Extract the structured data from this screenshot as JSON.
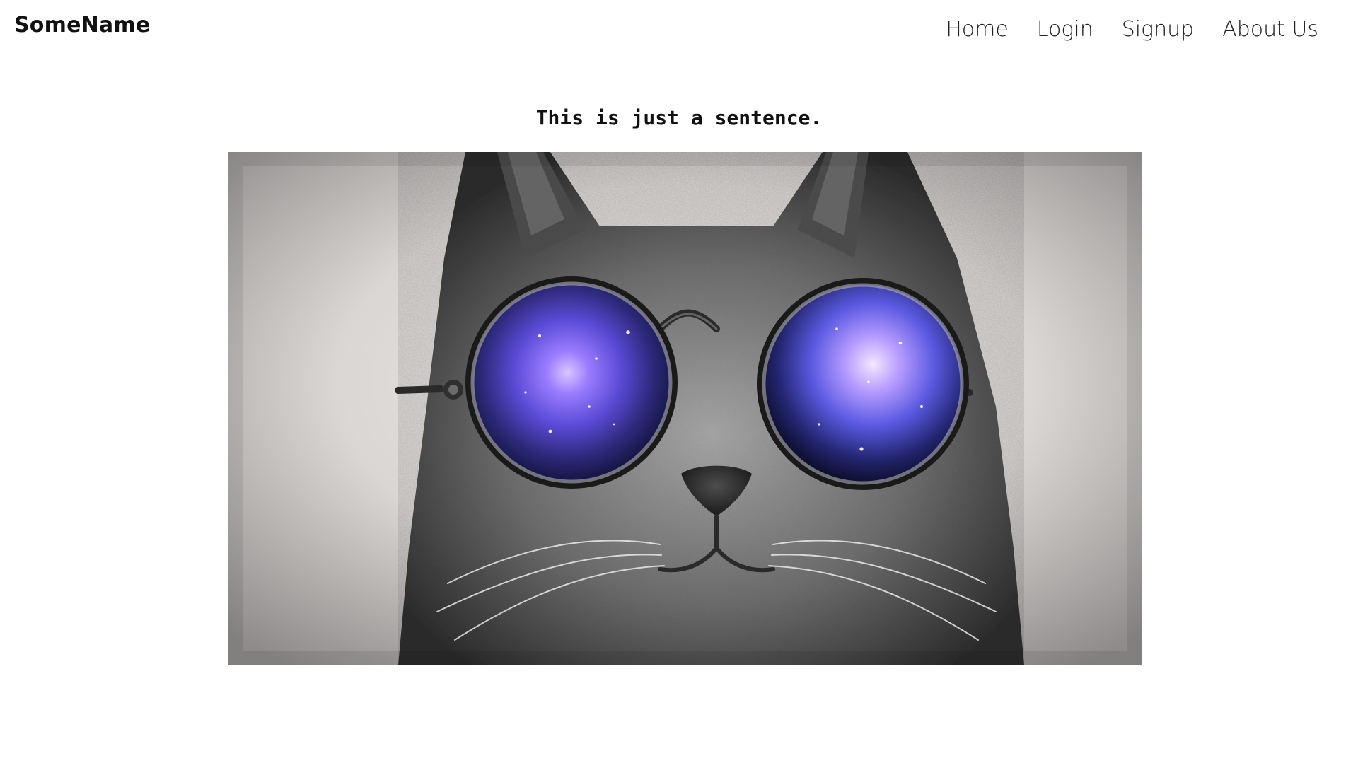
{
  "header": {
    "brand": "SomeName",
    "nav": [
      {
        "label": "Home"
      },
      {
        "label": "Login"
      },
      {
        "label": "Signup"
      },
      {
        "label": "About Us"
      }
    ]
  },
  "main": {
    "sentence": "This is just a sentence.",
    "hero_image": {
      "subject": "grey-cat-with-galaxy-round-sunglasses"
    }
  },
  "colors": {
    "background": "#ffffff",
    "text": "#111111",
    "nav_text": "#222222"
  }
}
